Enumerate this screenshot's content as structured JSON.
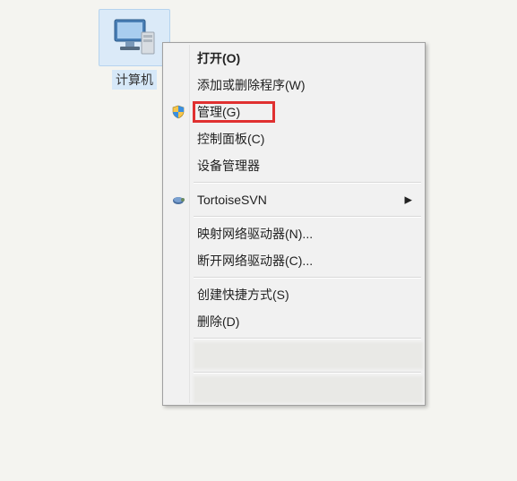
{
  "desktop": {
    "computer_label": "计算机"
  },
  "menu": {
    "open": "打开(O)",
    "add_remove_programs": "添加或删除程序(W)",
    "manage": "管理(G)",
    "control_panel": "控制面板(C)",
    "device_manager": "设备管理器",
    "tortoisesvn": "TortoiseSVN",
    "map_network_drive": "映射网络驱动器(N)...",
    "disconnect_network_drive": "断开网络驱动器(C)...",
    "create_shortcut": "创建快捷方式(S)",
    "delete": "删除(D)"
  },
  "icons": {
    "computer": "computer-icon",
    "shield": "shield-icon",
    "tortoise": "tortoisesvn-icon",
    "submenu_arrow": "▶"
  }
}
